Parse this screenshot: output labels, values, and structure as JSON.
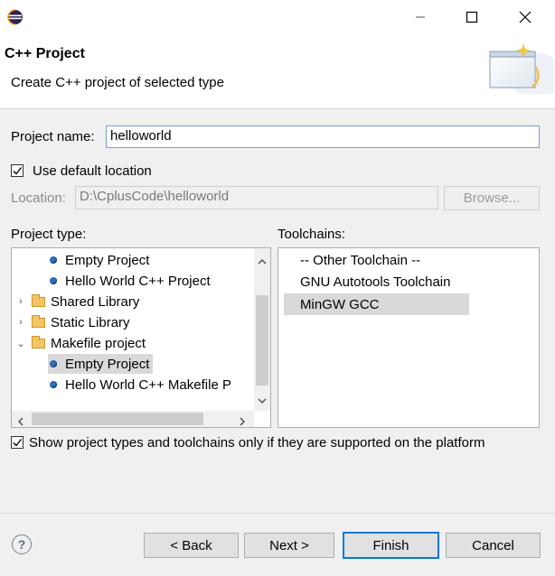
{
  "window": {
    "minimize": "—",
    "maximize": "☐",
    "close": "✕"
  },
  "header": {
    "title": "C++ Project",
    "subtitle": "Create C++ project of selected type"
  },
  "form": {
    "project_name_label": "Project name:",
    "project_name_value": "helloworld",
    "use_default_label": "Use default location",
    "use_default_checked": true,
    "location_label": "Location:",
    "location_value": "D:\\CplusCode\\helloworld",
    "browse_label": "Browse..."
  },
  "project_type": {
    "label": "Project type:",
    "items": [
      {
        "label": "Empty Project",
        "kind": "leaf",
        "level": 2,
        "selected": false
      },
      {
        "label": "Hello World C++ Project",
        "kind": "leaf",
        "level": 2,
        "selected": false
      },
      {
        "label": "Shared Library",
        "kind": "folder",
        "expanded": false,
        "level": 1
      },
      {
        "label": "Static Library",
        "kind": "folder",
        "expanded": false,
        "level": 1
      },
      {
        "label": "Makefile project",
        "kind": "folder",
        "expanded": true,
        "level": 1
      },
      {
        "label": "Empty Project",
        "kind": "leaf",
        "level": 2,
        "selected": true
      },
      {
        "label": "Hello World C++ Makefile P",
        "kind": "leaf",
        "level": 2,
        "selected": false
      }
    ]
  },
  "toolchains": {
    "label": "Toolchains:",
    "items": [
      {
        "label": "-- Other Toolchain --",
        "selected": false
      },
      {
        "label": "GNU Autotools Toolchain",
        "selected": false
      },
      {
        "label": "MinGW GCC",
        "selected": true
      }
    ]
  },
  "filter": {
    "label": "Show project types and toolchains only if they are supported on the platform",
    "checked": true
  },
  "buttons": {
    "back": "< Back",
    "next": "Next >",
    "finish": "Finish",
    "cancel": "Cancel",
    "help": "?"
  }
}
